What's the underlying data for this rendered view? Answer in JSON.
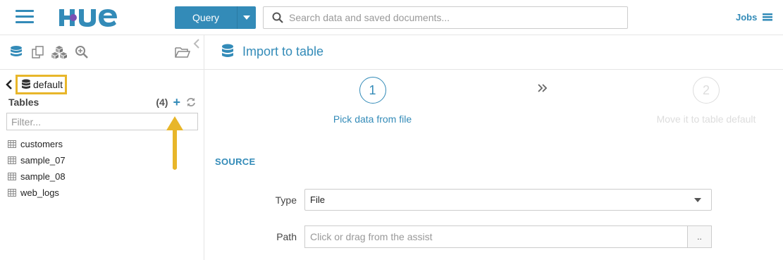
{
  "header": {
    "query_label": "Query",
    "search_placeholder": "Search data and saved documents...",
    "jobs_label": "Jobs"
  },
  "left_panel": {
    "database": "default",
    "tables_title": "Tables",
    "tables_count": "(4)",
    "filter_placeholder": "Filter...",
    "tables": [
      "customers",
      "sample_07",
      "sample_08",
      "web_logs"
    ]
  },
  "main": {
    "title": "Import to table",
    "steps": [
      {
        "number": "1",
        "label": "Pick data from file"
      },
      {
        "number": "2",
        "label": "Move it to table default"
      }
    ],
    "section_title": "SOURCE",
    "type_label": "Type",
    "type_value": "File",
    "path_label": "Path",
    "path_placeholder": "Click or drag from the assist",
    "browse_label": ".."
  },
  "colors": {
    "accent": "#338bb8",
    "highlight": "#e8b62a",
    "inactive": "#dddddd"
  }
}
